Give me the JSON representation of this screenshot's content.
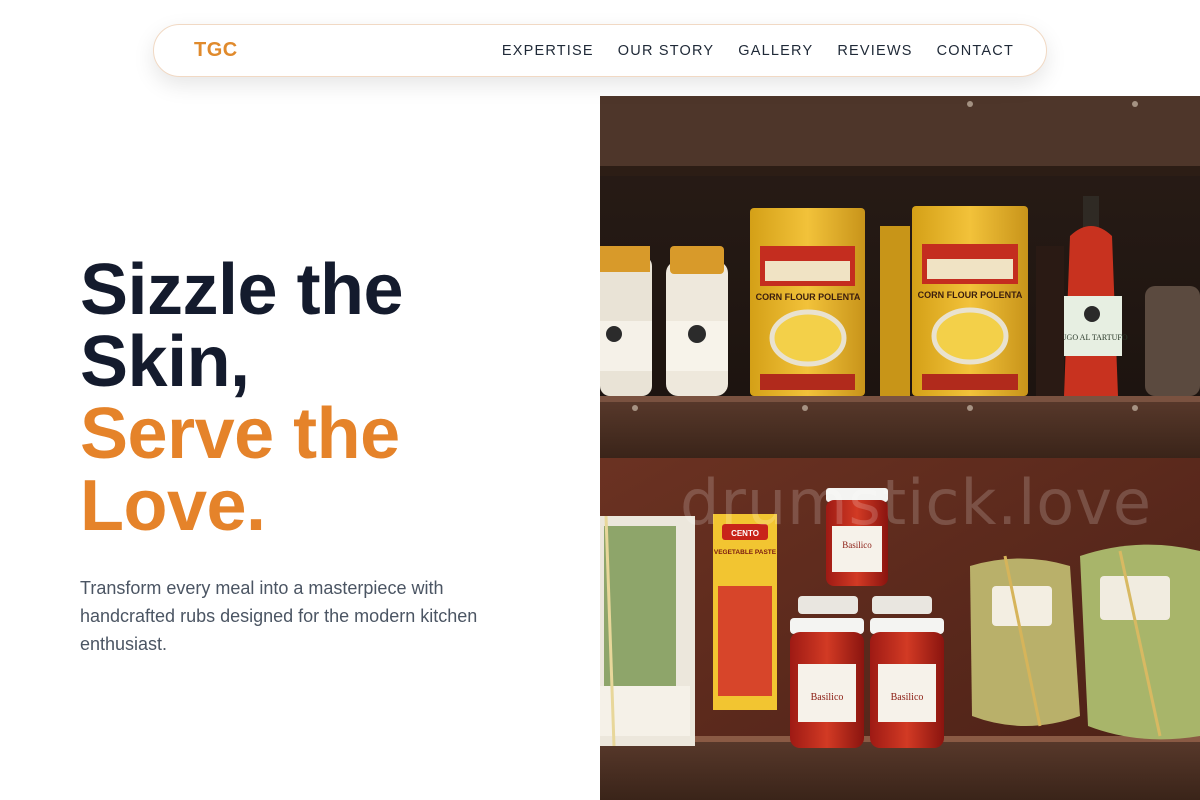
{
  "nav": {
    "logo": "TGC",
    "links": [
      "EXPERTISE",
      "OUR STORY",
      "GALLERY",
      "REVIEWS",
      "CONTACT"
    ]
  },
  "hero": {
    "title_line1": "Sizzle the",
    "title_line2": "Skin,",
    "title_line3": "Serve the",
    "title_line4": "Love.",
    "subtitle": "Transform every meal into a masterpiece with handcrafted rubs designed for the modern kitchen enthusiast."
  },
  "photo": {
    "watermark": "drumstick.love",
    "labels": {
      "polenta": "CORN FLOUR POLENTA",
      "sugo": "SUGO AL TARTUFO",
      "basilico": "Basilico",
      "paste": "VEGETABLE PASTE",
      "cento": "CENTO"
    }
  },
  "colors": {
    "accent": "#e5832a",
    "dark": "#141b2d",
    "text": "#4b5563"
  }
}
